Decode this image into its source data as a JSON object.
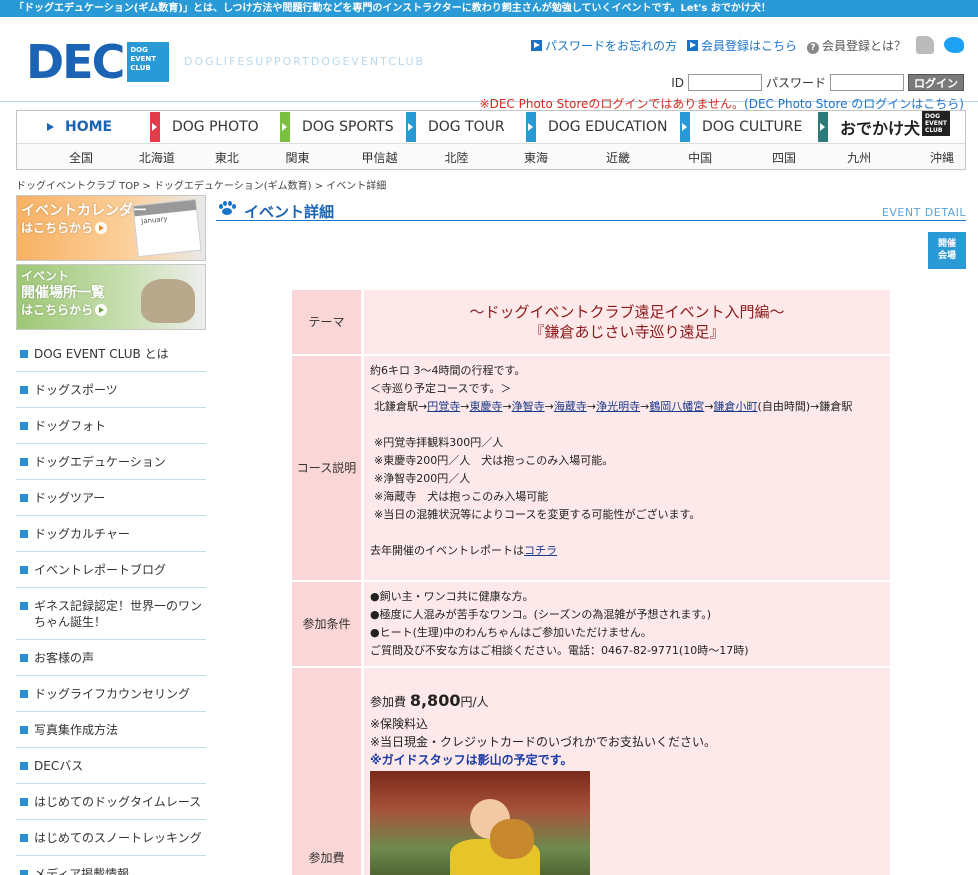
{
  "topbar": {
    "text": "「ドッグエデュケーション(ギム数育)」とは、しつけ方法や問題行動などを専門のインストラクターに教わり飼主さんが勉強していくイベントです。Let's おでかけ犬！"
  },
  "header": {
    "logo_text": "DEC",
    "logo_box": [
      "DOG",
      "EVENT",
      "CLUB"
    ],
    "tagline": "DOGLIFESUPPORTDOGEVENTCLUB",
    "links": {
      "forgot_password": "パスワードをお忘れの方",
      "register": "会員登録はこちら",
      "what_is_member": "会員登録とは？"
    },
    "login": {
      "id_label": "ID",
      "password_label": "パスワード",
      "button": "ログイン",
      "note_red": "※DEC Photo Storeのログインではありません。",
      "note_blue": "(DEC Photo Store のログインはこちら)"
    },
    "icons": {
      "dog": "dog-icon",
      "twitter": "twitter-icon"
    }
  },
  "gnav": {
    "items": [
      {
        "label": "HOME",
        "color": "#1a63b5"
      },
      {
        "label": "DOG PHOTO",
        "color": "#e23b4a"
      },
      {
        "label": "DOG SPORTS",
        "color": "#7bc043"
      },
      {
        "label": "DOG TOUR",
        "color": "#2a9ad6"
      },
      {
        "label": "DOG EDUCATION",
        "color": "#2a9ad6"
      },
      {
        "label": "DOG CULTURE",
        "color": "#2a9ad6"
      },
      {
        "label": "おでかけ犬",
        "color": "#2b7b7b",
        "badge": [
          "DOG",
          "EVENT",
          "CLUB"
        ]
      }
    ],
    "regions": [
      "全国",
      "北海道",
      "東北",
      "関東",
      "甲信越",
      "北陸",
      "東海",
      "近畿",
      "中国",
      "四国",
      "九州",
      "沖縄"
    ]
  },
  "breadcrumb": "ドッグイベントクラブ TOP > ドッグエデュケーション(ギム数育) > イベント詳細",
  "sidebar": {
    "banners": {
      "calendar": {
        "title": "イベントカレンダー",
        "sub": "はこちらから",
        "deco_text": "January"
      },
      "places": {
        "title1": "イベント",
        "title2": "開催場所一覧",
        "sub": "はこちらから"
      }
    },
    "menu": [
      "DOG EVENT CLUB とは",
      "ドッグスポーツ",
      "ドッグフォト",
      "ドッグエデュケーション",
      "ドッグツアー",
      "ドッグカルチャー",
      "イベントレポートブログ",
      "ギネス記録認定！世界一のワンちゃん誕生！",
      "お客様の声",
      "ドッグライフカウンセリング",
      "写真集作成方法",
      "DECバス",
      "はじめてのドッグタイムレース",
      "はじめてのスノートレッキング",
      "メディア掲載情報"
    ]
  },
  "main": {
    "title": "イベント詳細",
    "title_en": "EVENT DETAIL",
    "venue_button": [
      "開催",
      "会場"
    ],
    "rows": {
      "theme": {
        "label": "テーマ",
        "line1": "～ドッグイベントクラブ遠足イベント入門編～",
        "line2": "『鎌倉あじさい寺巡り遠足』"
      },
      "course": {
        "label": "コース説明",
        "intro": "約6キロ 3～4時間の行程です。",
        "planned": "＜寺巡り予定コースです。＞",
        "route_start": "北鎌倉駅→",
        "route_stops": [
          "円覚寺",
          "東慶寺",
          "浄智寺",
          "海蔵寺",
          "浄光明寺",
          "鶴岡八幡宮",
          "鎌倉小町"
        ],
        "route_end": "(自由時間)→鎌倉駅",
        "notes": [
          "※円覚寺拝観料300円／人",
          "※東慶寺200円／人　犬は抱っこのみ入場可能。",
          "※浄智寺200円／人",
          "※海蔵寺　犬は抱っこのみ入場可能",
          "※当日の混雑状況等によりコースを変更する可能性がございます。"
        ],
        "report_prefix": "去年開催のイベントレポートは",
        "report_link": "コチラ"
      },
      "conditions": {
        "label": "参加条件",
        "items": [
          "●飼い主・ワンコ共に健康な方。",
          "●極度に人混みが苦手なワンコ。(シーズンの為混雑が予想されます。)",
          "●ヒート(生理)中のわんちゃんはご参加いただけません。",
          "ご質問及び不安な方はご相談ください。電話：0467-82-9771(10時～17時)"
        ]
      },
      "fee": {
        "label": "参加費",
        "prefix": "参加費",
        "amount": "8,800",
        "unit": "円/人",
        "lines": [
          "※保険料込",
          "※当日現金・クレジットカードのいづれかでお支払いください。"
        ],
        "guide": "※ガイドスタッフは影山の予定です。"
      }
    }
  }
}
